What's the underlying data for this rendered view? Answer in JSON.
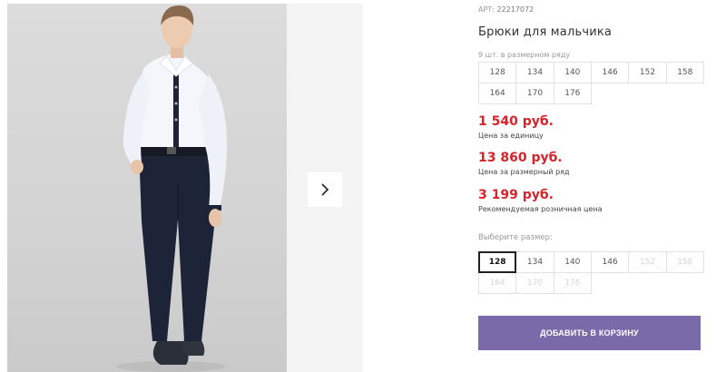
{
  "product": {
    "sku_label": "АРТ:",
    "sku": "22217072",
    "title": "Брюки для мальчика",
    "pack_note": "9 шт. в размерном ряду"
  },
  "pack_sizes": [
    "128",
    "134",
    "140",
    "146",
    "152",
    "158",
    "164",
    "170",
    "176"
  ],
  "prices": {
    "unit_price": "1 540 руб.",
    "unit_label": "Цена за единицу",
    "pack_price": "13 860 руб.",
    "pack_label": "Цена за размерный ряд",
    "retail_price": "3 199 руб.",
    "retail_label": "Рекомендуемая розничная цена"
  },
  "size_picker": {
    "label": "Выберите размер:",
    "options": [
      {
        "value": "128",
        "state": "selected"
      },
      {
        "value": "134",
        "state": "available"
      },
      {
        "value": "140",
        "state": "available"
      },
      {
        "value": "146",
        "state": "available"
      },
      {
        "value": "152",
        "state": "disabled"
      },
      {
        "value": "158",
        "state": "disabled"
      },
      {
        "value": "164",
        "state": "disabled"
      },
      {
        "value": "170",
        "state": "disabled"
      },
      {
        "value": "176",
        "state": "disabled"
      }
    ]
  },
  "actions": {
    "add_to_cart": "ДОБАВИТЬ В КОРЗИНУ"
  },
  "colors": {
    "price": "#d8232a",
    "button": "#7b6aa9"
  }
}
